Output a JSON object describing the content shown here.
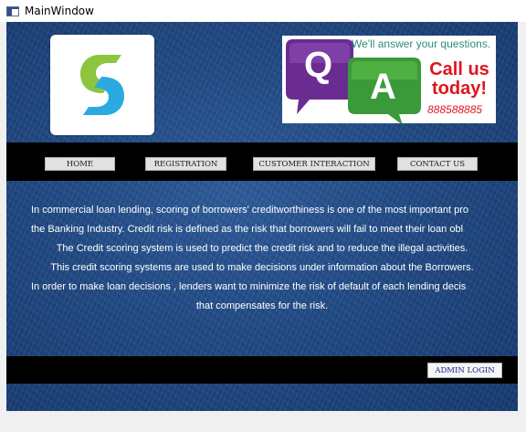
{
  "window": {
    "title": "MainWindow"
  },
  "banner": {
    "answer_text": "We'll answer your questions.",
    "q_letter": "Q",
    "a_letter": "A",
    "call_line1": "Call us",
    "call_line2": "today!",
    "phone": "888588885"
  },
  "nav": {
    "home": "HOME",
    "registration": "REGISTRATION",
    "customer_interaction": "CUSTOMER INTERACTION",
    "contact_us": "CONTACT US"
  },
  "content": {
    "lines": [
      "In commercial loan lending, scoring of borrowers' creditworthiness is one of the most important pro",
      "the Banking Industry. Credit risk is defined as the risk that borrowers will fail to meet their loan obl",
      "The Credit scoring system is used to predict the credit risk and to reduce the illegal activities.",
      "This credit scoring systems are used to make decisions under information about the Borrowers.",
      "In order to make loan decisions , lenders want to minimize the risk of default of each lending decis",
      "that compensates for the risk."
    ]
  },
  "footer": {
    "admin_login": "ADMIN LOGIN"
  },
  "colors": {
    "background_blue": "#214a85",
    "bar_black": "#000000",
    "logo_green": "#8cc63f",
    "logo_blue": "#29abe2",
    "q_purple": "#6a2c91",
    "a_green": "#3a9a3a",
    "call_red": "#e0141c"
  },
  "icons": {
    "window_icon": "app-window-icon",
    "logo": "s-logo-icon"
  }
}
